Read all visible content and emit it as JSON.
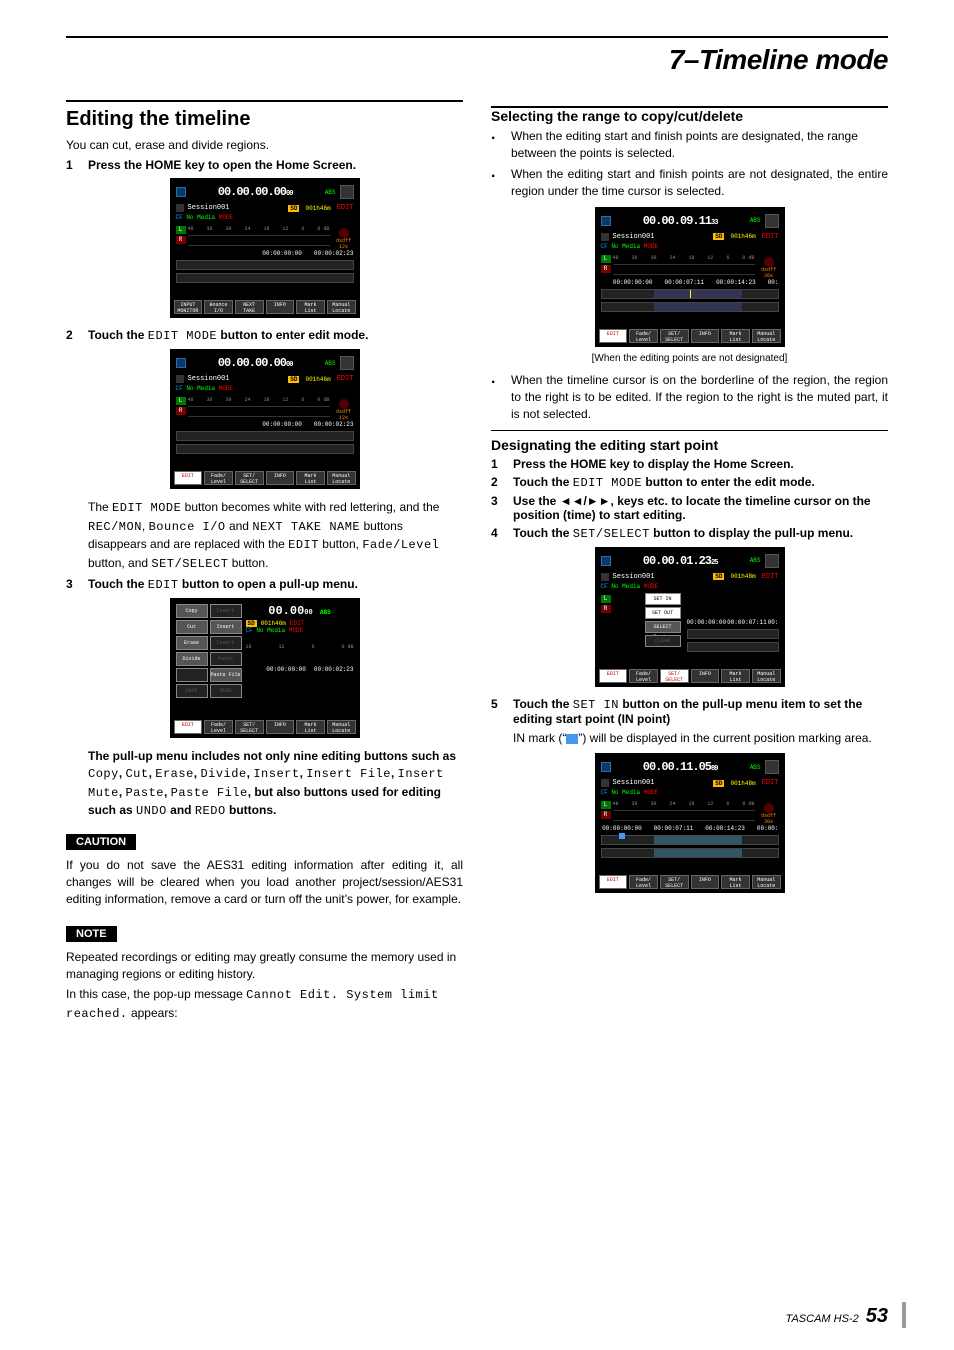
{
  "header": {
    "chapter_title": "7–Timeline mode"
  },
  "footer": {
    "product": "TASCAM HS-2",
    "page": "53"
  },
  "left": {
    "h2": "Editing the timeline",
    "intro": "You can cut, erase and divide regions.",
    "step1": {
      "num": "1",
      "text_bold": "Press the HOME key to open the Home Screen."
    },
    "step2": {
      "num": "2",
      "text_a": "Touch the ",
      "mono": "EDIT MODE",
      "text_b": " button to enter edit mode."
    },
    "after2_p1_a": "The ",
    "after2_p1_m1": "EDIT MODE",
    "after2_p1_b": " button becomes white with red lettering, and the ",
    "after2_p1_m2": "REC/MON",
    "after2_p1_c": ", ",
    "after2_p1_m3": "Bounce I/O",
    "after2_p1_d": " and ",
    "after2_p1_m4": "NEXT TAKE NAME",
    "after2_p1_e": " buttons disappears and are replaced with the ",
    "after2_p1_m5": "EDIT",
    "after2_p1_f": " button, ",
    "after2_p1_m6": "Fade/Level",
    "after2_p1_g": " button, and ",
    "after2_p1_m7": "SET/SELECT",
    "after2_p1_h": " button.",
    "step3": {
      "num": "3",
      "text_a": "Touch the ",
      "mono": "EDIT",
      "text_b": " button to open a pull-up menu."
    },
    "pullup_p_a": "The pull-up menu includes not only nine editing buttons such as ",
    "pullup_m1": "Copy",
    "pullup_m2": "Cut",
    "pullup_m3": "Erase",
    "pullup_m4": "Divide",
    "pullup_m5": "Insert",
    "pullup_m6": "Insert File",
    "pullup_m7": "Insert Mute",
    "pullup_m8": "Paste",
    "pullup_m9": "Paste File",
    "pullup_p_b": ", but also buttons used for editing such as ",
    "pullup_m10": "UNDO",
    "pullup_p_and": " and ",
    "pullup_m11": "REDO",
    "pullup_p_c": " buttons.",
    "caution_label": "CAUTION",
    "caution_text": "If you do not save the AES31 editing information after editing it, all changes will be cleared when you load another project/session/AES31 editing information, remove a card or turn off the unit’s power, for example.",
    "note_label": "NOTE",
    "note_text_a": "Repeated recordings or editing may greatly consume the memory used in managing regions or editing history.",
    "note_text_b": "In this case, the pop-up message ",
    "note_mono": "Cannot Edit. System limit reached.",
    "note_text_c": " appears:"
  },
  "right": {
    "h3_1": "Selecting the range to copy/cut/delete",
    "b1": "When the editing start and finish points are designated, the range between the points is selected.",
    "b2": "When the editing start and finish points are not designated, the entire region under the time cursor is selected.",
    "caption1": "[When the editing points are not designated]",
    "b3": "When the timeline cursor is on the borderline of the region, the region to the right is to be edited. If the region to the right is the muted part, it is not selected.",
    "h3_2": "Designating the editing start point",
    "s1": {
      "num": "1",
      "text": "Press the HOME key to display the Home Screen."
    },
    "s2": {
      "num": "2",
      "text_a": "Touch the ",
      "mono": "EDIT MODE",
      "text_b": " button to enter the edit mode."
    },
    "s3": {
      "num": "3",
      "text_a": "Use the ",
      "transport": "◄◄/►►",
      "text_b": ", keys etc. to locate the timeline cursor on the position (time) to start editing."
    },
    "s4": {
      "num": "4",
      "text_a": "Touch the ",
      "mono": "SET/SELECT",
      "text_b": " button to display the pull-up menu."
    },
    "s5": {
      "num": "5",
      "text_a": "Touch the ",
      "mono": "SET IN",
      "text_b": " button on the pull-up menu item to set the editing start point (IN point)"
    },
    "s5_after_a": "IN mark (“",
    "s5_after_b": "”) will be displayed in the current position marking area."
  },
  "shot_common": {
    "session": "Session001",
    "sd": "SD",
    "sdtime": "001h46m",
    "edit": "EDIT",
    "cf": "CF",
    "nomedia": "No Media",
    "mode": "MODE",
    "L": "L",
    "R": "R",
    "ticks": [
      "48",
      "36",
      "30",
      "24",
      "18",
      "12",
      "6",
      "0 dB"
    ],
    "dsdff": "dsdff",
    "abs": "ABS"
  },
  "shot1": {
    "tc": "00.00.00.00",
    "tc_cc": "00",
    "t1": "00:00:00:00",
    "t2": "00:00:02:23",
    "s_rate": "12s",
    "btns": [
      "INPUT MONITOR",
      "Bounce I/O",
      "NEXT TAKE NAME",
      "INFO",
      "Mark List",
      "Manual Locate"
    ]
  },
  "shot2": {
    "tc": "00.00.00.00",
    "tc_cc": "00",
    "t1": "00:00:00:00",
    "t2": "00:00:02:23",
    "s_rate": "12s",
    "btns": [
      "EDIT",
      "Fade/ Level",
      "SET/ SELECT",
      "INFO",
      "Mark List",
      "Manual Locate"
    ]
  },
  "shot3": {
    "tc": "00.00",
    "tc_cc": "00",
    "sdtime": "001h46m",
    "t1": "00:00:00:00",
    "t2": "00:00:02:23",
    "s_rate": "12s",
    "menuL": [
      "Copy",
      "Cut",
      "Erase",
      "Divide",
      "",
      "UNDO"
    ],
    "menuR": [
      "Insert",
      "Insert File",
      "Insert Mute",
      "Paste",
      "Paste File",
      "REDO"
    ],
    "btns": [
      "EDIT",
      "Fade/ Level",
      "SET/ SELECT",
      "INFO",
      "Mark List",
      "Manual Locate"
    ]
  },
  "shot4": {
    "tc": "00.00.09.11",
    "tc_cc": "33",
    "sdtime": "001h46m",
    "t1": "00:00:00:00",
    "t2": "00:00:07:11",
    "t3": "00:00:14:23",
    "t4": "00:",
    "s_rate": "30s",
    "btns": [
      "EDIT",
      "Fade/ Level",
      "SET/ SELECT",
      "INFO",
      "Mark List",
      "Manual Locate"
    ]
  },
  "shot5": {
    "tc": "00.00.01.23",
    "tc_cc": "25",
    "sdtime": "001h48m",
    "t1": "00:00:00:00",
    "t2": "00:00:07:11",
    "t3": "00:",
    "s_rate": "30s",
    "side": [
      "SET IN",
      "SET OUT",
      "SELECT Region",
      "CLEAR"
    ],
    "btns": [
      "EDIT",
      "Fade/ Level",
      "SET/ SELECT",
      "INFO",
      "Mark List",
      "Manual Locate"
    ]
  },
  "shot6": {
    "tc": "00.00.11.05",
    "tc_cc": "89",
    "sdtime": "001h48m",
    "t1": "00:00:00:00",
    "t2": "00:00:07:11",
    "t3": "00:00:14:23",
    "t4": "00:00:",
    "s_rate": "30s",
    "btns": [
      "EDIT",
      "Fade/ Level",
      "SET/ SELECT",
      "INFO",
      "Mark List",
      "Manual Locate"
    ]
  }
}
